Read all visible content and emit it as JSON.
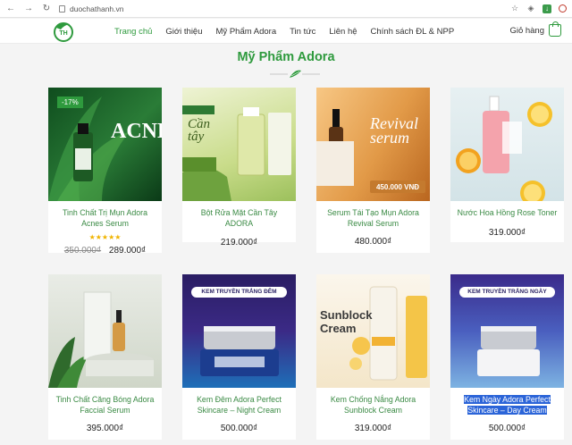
{
  "browser": {
    "url": "duochathanh.vn"
  },
  "nav": {
    "items": [
      "Trang chủ",
      "Giới thiệu",
      "Mỹ Phẩm Adora",
      "Tin tức",
      "Liên hệ",
      "Chính sách ĐL & NPP"
    ],
    "cart_label": "Giỏ hàng"
  },
  "section": {
    "title": "Mỹ Phẩm Adora"
  },
  "products": [
    {
      "name": "Tinh Chất Trị Mụn Adora Acnes Serum",
      "old_price": "350.000₫",
      "price": "289.000₫",
      "badge": "-17%",
      "rating": "★★★★★",
      "image_text": "ACNE"
    },
    {
      "name": "Bột Rửa Mặt Cần Tây ADORA",
      "price": "219.000₫",
      "image_text": "Cần tây"
    },
    {
      "name": "Serum Tái Tạo Mụn Adora Revival Serum",
      "price": "480.000₫",
      "image_text": "Revival serum",
      "image_price": "450.000 VNĐ"
    },
    {
      "name": "Nước Hoa Hồng Rose Toner",
      "price": "319.000₫"
    },
    {
      "name": "Tinh Chất Căng Bóng Adora Faccial Serum",
      "price": "395.000₫"
    },
    {
      "name": "Kem Đêm Adora Perfect Skincare – Night Cream",
      "price": "500.000₫",
      "image_banner": "KEM TRUYỀN TRẮNG ĐÊM"
    },
    {
      "name": "Kem Chống Nắng Adora Sunblock Cream",
      "price": "319.000₫",
      "image_text": "Sunblock Cream"
    },
    {
      "name_line1": "Kem Ngày Adora Perfect",
      "name_line2": "Skincare – Day Cream",
      "price": "500.000₫",
      "image_banner": "KEM TRUYỀN TRẮNG NGÀY"
    }
  ],
  "colors": {
    "brand_green": "#2e9a3d",
    "selection": "#2b64d8"
  }
}
